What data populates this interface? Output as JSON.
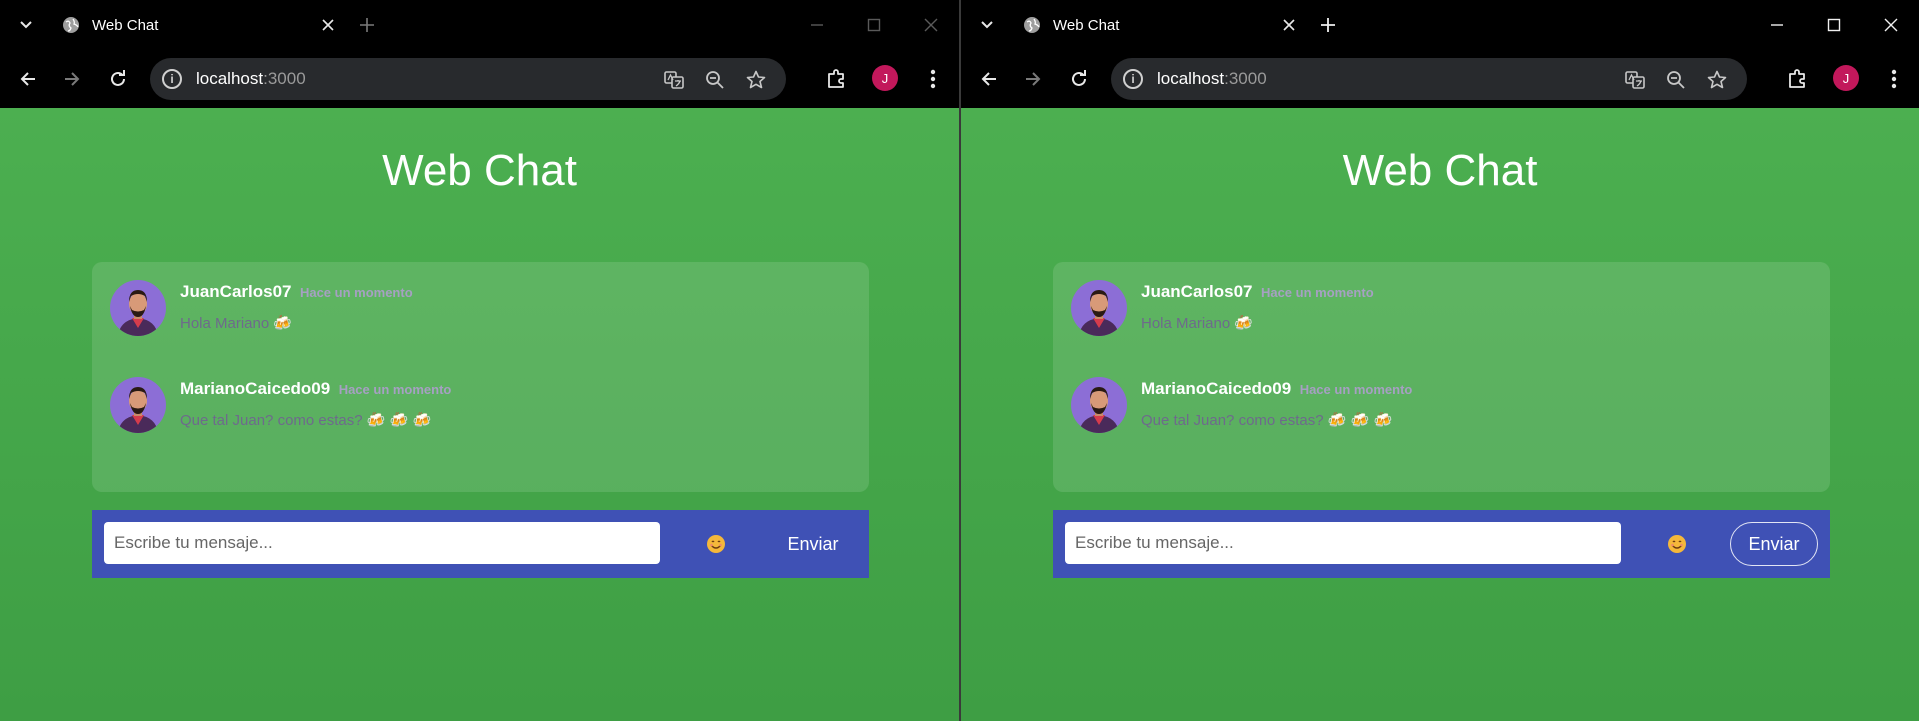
{
  "windows": [
    {
      "tab": {
        "title": "Web Chat"
      },
      "address": {
        "host": "localhost",
        "port": ":3000"
      },
      "profile_initial": "J",
      "page": {
        "title": "Web Chat",
        "messages": [
          {
            "username": "JuanCarlos07",
            "time": "Hace un momento",
            "text": "Hola Mariano 🍻"
          },
          {
            "username": "MarianoCaicedo09",
            "time": "Hace un momento",
            "text": "Que tal Juan? como estas? 🍻 🍻 🍻"
          }
        ],
        "composer": {
          "placeholder": "Escribe tu mensaje...",
          "emoji": "😊",
          "send_label": "Enviar"
        }
      }
    },
    {
      "tab": {
        "title": "Web Chat"
      },
      "address": {
        "host": "localhost",
        "port": ":3000"
      },
      "profile_initial": "J",
      "page": {
        "title": "Web Chat",
        "messages": [
          {
            "username": "JuanCarlos07",
            "time": "Hace un momento",
            "text": "Hola Mariano 🍻"
          },
          {
            "username": "MarianoCaicedo09",
            "time": "Hace un momento",
            "text": "Que tal Juan? como estas? 🍻 🍻 🍻"
          }
        ],
        "composer": {
          "placeholder": "Escribe tu mensaje...",
          "emoji": "😊",
          "send_label": "Enviar"
        }
      }
    }
  ],
  "colors": {
    "page_background": "#4caf50",
    "composer_background": "#3f51b5",
    "profile_badge": "#c2185b"
  },
  "icons": [
    "tab-list-icon",
    "globe-icon",
    "close-icon",
    "plus-icon",
    "minimize-icon",
    "maximize-icon",
    "window-close-icon",
    "back-arrow-icon",
    "forward-arrow-icon",
    "reload-icon",
    "site-info-icon",
    "translate-icon",
    "zoom-icon",
    "star-icon",
    "extensions-icon",
    "kebab-menu-icon",
    "avatar-icon",
    "smile-emoji-icon"
  ]
}
